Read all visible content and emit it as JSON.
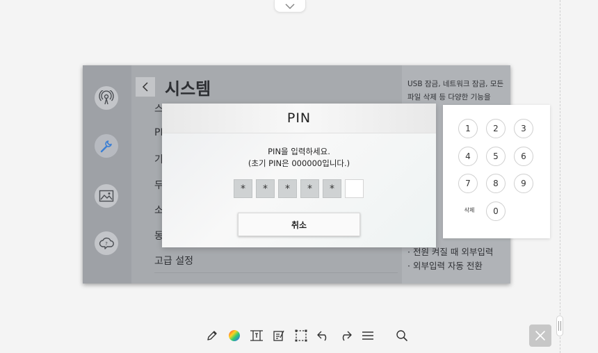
{
  "screen": {
    "title": "시스템",
    "menu_items": [
      "스",
      "PI",
      "기",
      "두",
      "소",
      "동",
      "고급 설정"
    ],
    "description_top": "USB 잠금, 네트워크 잠금, 모든 파일 삭제 등 다양한 기능을",
    "description_bottom": [
      "· 전원 켜질 때 외부입력",
      "· 외부입력 자동 전환"
    ]
  },
  "pin_dialog": {
    "title": "PIN",
    "message_line1": "PIN을 입력하세요.",
    "message_line2": "(초기 PIN은 000000입니다.)",
    "entered_digits": [
      "*",
      "*",
      "*",
      "*",
      "*",
      ""
    ],
    "cancel_label": "취소"
  },
  "keypad": {
    "keys": [
      "1",
      "2",
      "3",
      "4",
      "5",
      "6",
      "7",
      "8",
      "9",
      "0"
    ],
    "delete_label": "삭제"
  },
  "toolbar": {
    "tools": [
      "pencil-icon",
      "color-wheel-icon",
      "text-frame-icon",
      "edit-note-icon",
      "selection-icon",
      "undo-icon",
      "redo-icon",
      "menu-icon",
      "search-icon"
    ]
  },
  "colors": {
    "accent_active": "#3b7fd4",
    "tv_background": "#a9acb0"
  }
}
